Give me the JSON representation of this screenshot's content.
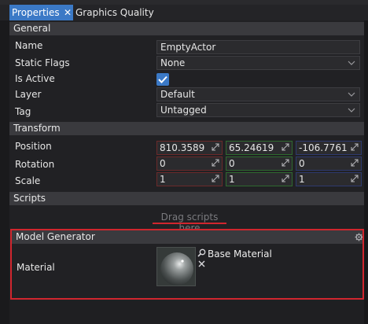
{
  "tabs": [
    {
      "label": "Properties",
      "active": true
    },
    {
      "label": "Graphics Quality",
      "active": false
    }
  ],
  "general": {
    "header": "General",
    "name_label": "Name",
    "name_value": "EmptyActor",
    "static_flags_label": "Static Flags",
    "static_flags_value": "None",
    "is_active_label": "Is Active",
    "is_active_checked": true,
    "layer_label": "Layer",
    "layer_value": "Default",
    "tag_label": "Tag",
    "tag_value": "Untagged"
  },
  "transform": {
    "header": "Transform",
    "position_label": "Position",
    "position": {
      "x": "810.3589",
      "y": "65.24619",
      "z": "-106.7761"
    },
    "rotation_label": "Rotation",
    "rotation": {
      "x": "0",
      "y": "0",
      "z": "0"
    },
    "scale_label": "Scale",
    "scale": {
      "x": "1",
      "y": "1",
      "z": "1"
    }
  },
  "scripts": {
    "header": "Scripts",
    "drag_hint": "Drag scripts here"
  },
  "model_generator": {
    "header": "Model Generator",
    "material_label": "Material",
    "material_value": "Base Material"
  },
  "colors": {
    "accent": "#3b79c6",
    "highlight_red": "#d0262e",
    "x_axis": "#6b2a2a",
    "y_axis": "#2f6a2f",
    "z_axis": "#2e3a6e"
  },
  "icons": [
    "close-icon",
    "chevron-down-icon",
    "checkmark-icon",
    "expand-arrow-icon",
    "gear-icon",
    "magnify-icon",
    "remove-icon",
    "sphere-thumbnail"
  ]
}
